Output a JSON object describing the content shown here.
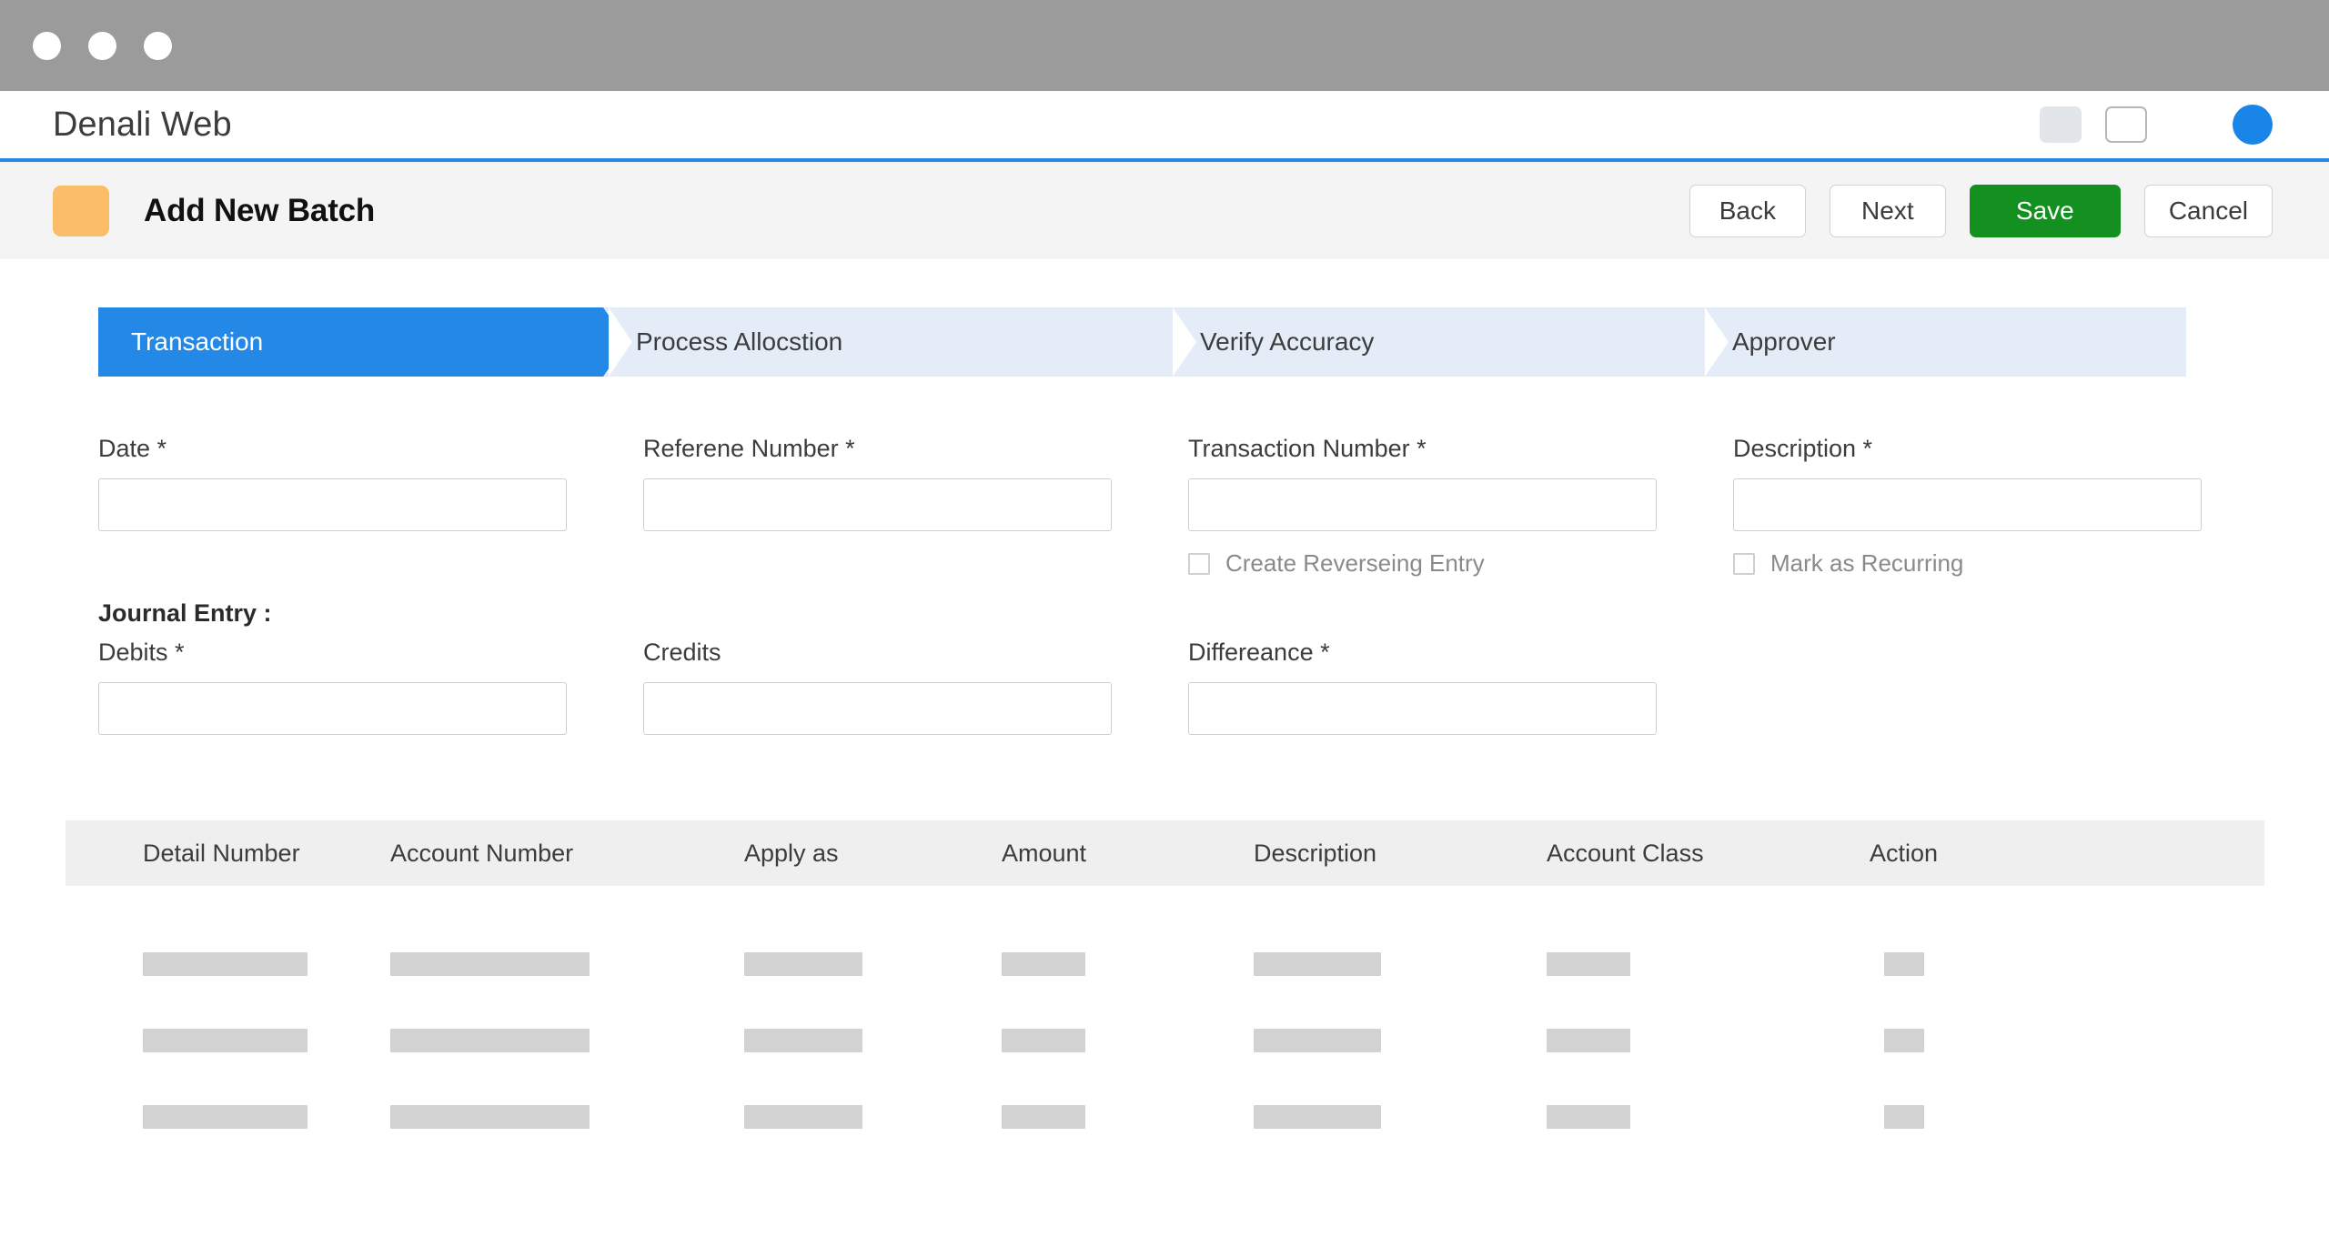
{
  "window": {
    "traffic_lights": [
      "close-dot",
      "minimize-dot",
      "maximize-dot"
    ]
  },
  "header": {
    "app_title": "Denali Web",
    "accent_color": "#2489e6",
    "controls": [
      {
        "name": "header-square-filled"
      },
      {
        "name": "header-square-outline"
      }
    ],
    "avatar_color": "#1a85e8"
  },
  "page_bar": {
    "icon_color": "#fbbd68",
    "title": "Add New Batch",
    "actions": [
      {
        "label": "Back",
        "style": "secondary"
      },
      {
        "label": "Next",
        "style": "secondary"
      },
      {
        "label": "Save",
        "style": "primary",
        "color": "#13901f"
      },
      {
        "label": "Cancel",
        "style": "secondary"
      }
    ]
  },
  "stepper": {
    "active_index": 0,
    "active_color": "#2489e6",
    "inactive_color": "#e3ecf7",
    "steps": [
      {
        "label": "Transaction"
      },
      {
        "label": "Process Allocstion"
      },
      {
        "label": "Verify Accuracy"
      },
      {
        "label": "Approver"
      }
    ]
  },
  "form": {
    "row1": [
      {
        "label": "Date *",
        "value": "",
        "placeholder": ""
      },
      {
        "label": "Referene Number *",
        "value": "",
        "placeholder": ""
      },
      {
        "label": "Transaction Number *",
        "value": "",
        "placeholder": ""
      },
      {
        "label": "Description *",
        "value": "",
        "placeholder": ""
      }
    ],
    "checkboxes": [
      {
        "label": "Create Reverseing Entry",
        "checked": false
      },
      {
        "label": "Mark as Recurring",
        "checked": false
      }
    ],
    "journal_entry_title": "Journal Entry :",
    "row2": [
      {
        "label": "Debits *",
        "value": "",
        "placeholder": ""
      },
      {
        "label": "Credits",
        "value": "",
        "placeholder": ""
      },
      {
        "label": "Differeance *",
        "value": "",
        "placeholder": ""
      }
    ]
  },
  "table": {
    "columns": [
      "Detail Number",
      "Account Number",
      "Apply as",
      "Amount",
      "Description",
      "Account Class",
      "Action"
    ],
    "rows": [
      {
        "widths": [
          181,
          219,
          130,
          92,
          140,
          92,
          44
        ]
      },
      {
        "widths": [
          181,
          219,
          130,
          92,
          140,
          92,
          44
        ]
      },
      {
        "widths": [
          181,
          219,
          130,
          92,
          140,
          92,
          44
        ]
      }
    ],
    "placeholder_color": "#d2d2d2"
  }
}
